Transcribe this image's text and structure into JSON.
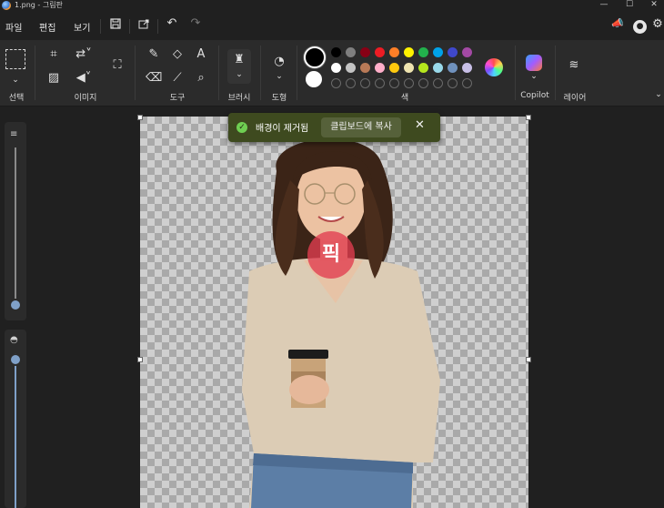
{
  "window": {
    "title": "1.png - 그림판",
    "minimize_icon": "minimize-icon",
    "maximize_icon": "maximize-icon",
    "close_icon": "close-icon"
  },
  "menubar": {
    "items": [
      "파일",
      "편집",
      "보기"
    ],
    "save_icon": "save-icon",
    "share_icon": "share-icon",
    "undo_icon": "undo-icon",
    "redo_icon": "redo-icon",
    "right": [
      "feedback-icon",
      "account-icon",
      "settings-icon"
    ]
  },
  "ribbon": {
    "groups": {
      "select": "선택",
      "image": "이미지",
      "tools": "도구",
      "brushes": "브러시",
      "shapes": "도형",
      "colors": "색",
      "copilot": "Copilot",
      "layers": "레이어"
    },
    "primary_color": "#000000",
    "secondary_color": "#ffffff",
    "palette_row1": [
      "#000000",
      "#7f7f7f",
      "#880015",
      "#ed1c24",
      "#ff7f27",
      "#fff200",
      "#22b14c",
      "#00a2e8",
      "#3f48cc",
      "#a349a4"
    ],
    "palette_row2": [
      "#ffffff",
      "#c3c3c3",
      "#b97a57",
      "#ffaec9",
      "#ffc90e",
      "#efe4b0",
      "#b5e61d",
      "#99d9ea",
      "#7092be",
      "#c8bfe7"
    ]
  },
  "toast": {
    "message": "배경이 제거됨",
    "button": "클립보드에 복사",
    "check_icon": "check-icon",
    "close_icon": "close-icon"
  },
  "watermark": {
    "text": "픽"
  },
  "sidebar": {
    "brush_size_icon": "brush-size-icon",
    "opacity_icon": "opacity-icon",
    "size_level": 0.0,
    "opacity_level": 1.0
  }
}
